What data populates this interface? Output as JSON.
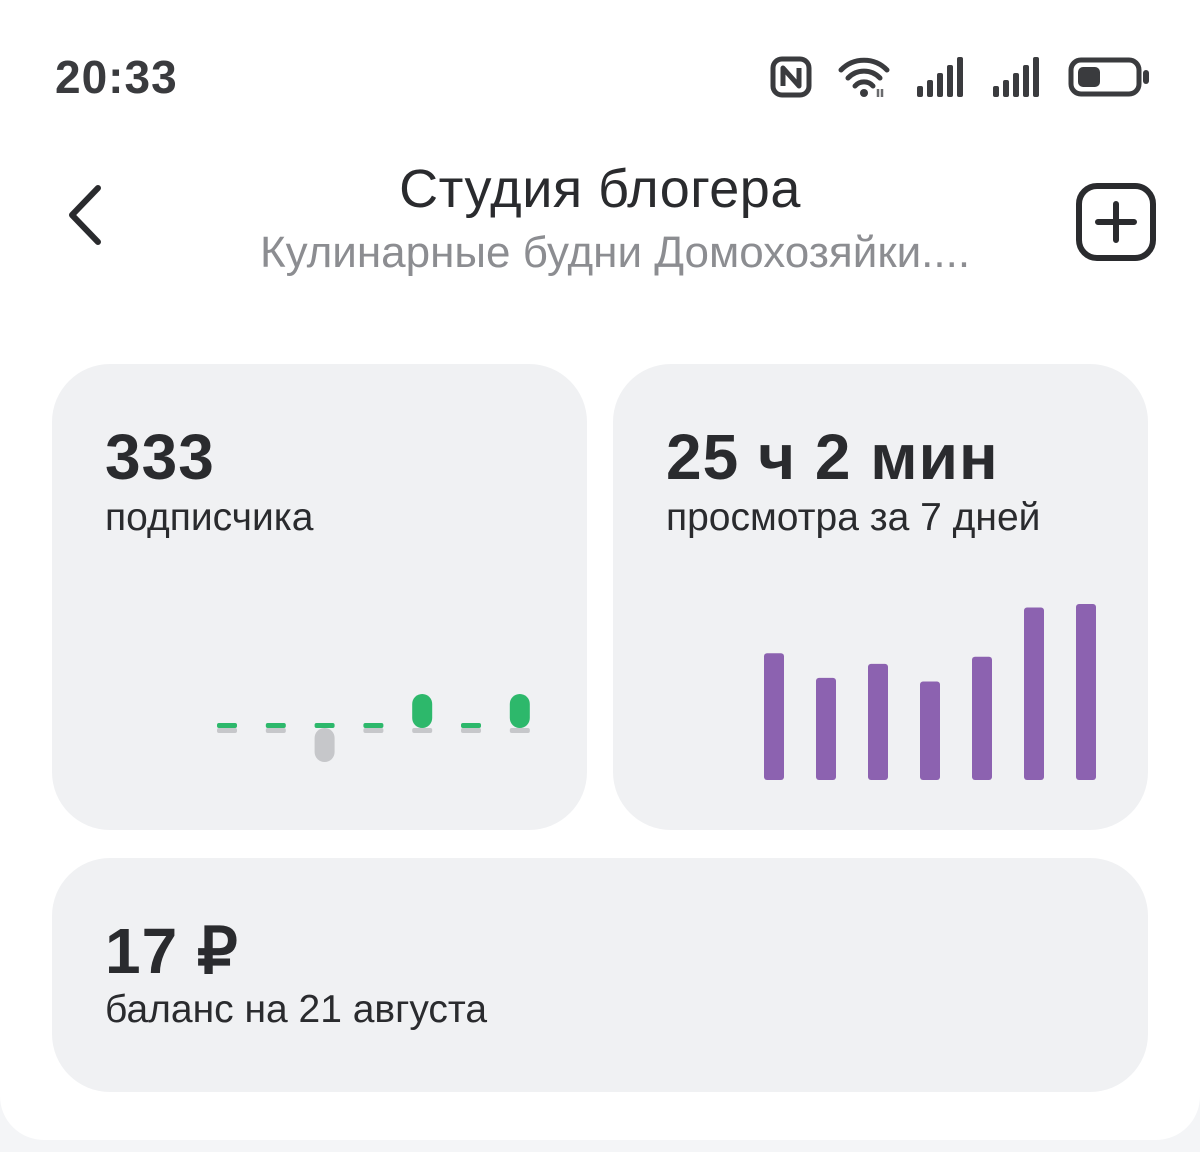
{
  "status_bar": {
    "time": "20:33",
    "icons": [
      "nfc-icon",
      "wifi-icon",
      "signal-icon",
      "signal-icon",
      "battery-icon"
    ]
  },
  "header": {
    "title": "Студия блогера",
    "subtitle": "Кулинарные будни Домохозяйки....",
    "back_icon": "chevron-left-icon",
    "add_icon": "plus-square-icon"
  },
  "subscribers": {
    "value": "333",
    "label": "подписчика"
  },
  "views": {
    "value": "25 ч 2 мин",
    "label": "просмотра за 7 дней"
  },
  "balance": {
    "value": "17 ₽",
    "label": "баланс на 21 августа"
  },
  "colors": {
    "accent_green": "#2db86b",
    "negative_gray": "#c6c7ca",
    "accent_purple": "#8c62b0",
    "card_bg": "#f0f1f3",
    "text": "#2a2b2e",
    "muted_text": "#8c8d91"
  },
  "chart_data": [
    {
      "type": "bar",
      "series": [
        {
          "values": [
            0,
            0,
            0,
            0,
            1,
            0,
            1
          ]
        },
        {
          "values": [
            0,
            0,
            -1,
            0,
            0,
            0,
            0
          ]
        }
      ],
      "categories": [
        "1",
        "2",
        "3",
        "4",
        "5",
        "6",
        "7"
      ],
      "grid": false
    },
    {
      "type": "bar",
      "categories": [
        "1",
        "2",
        "3",
        "4",
        "5",
        "6",
        "7"
      ],
      "values": [
        3.6,
        2.9,
        3.3,
        2.8,
        3.5,
        4.9,
        5.0
      ],
      "grid": false
    }
  ]
}
